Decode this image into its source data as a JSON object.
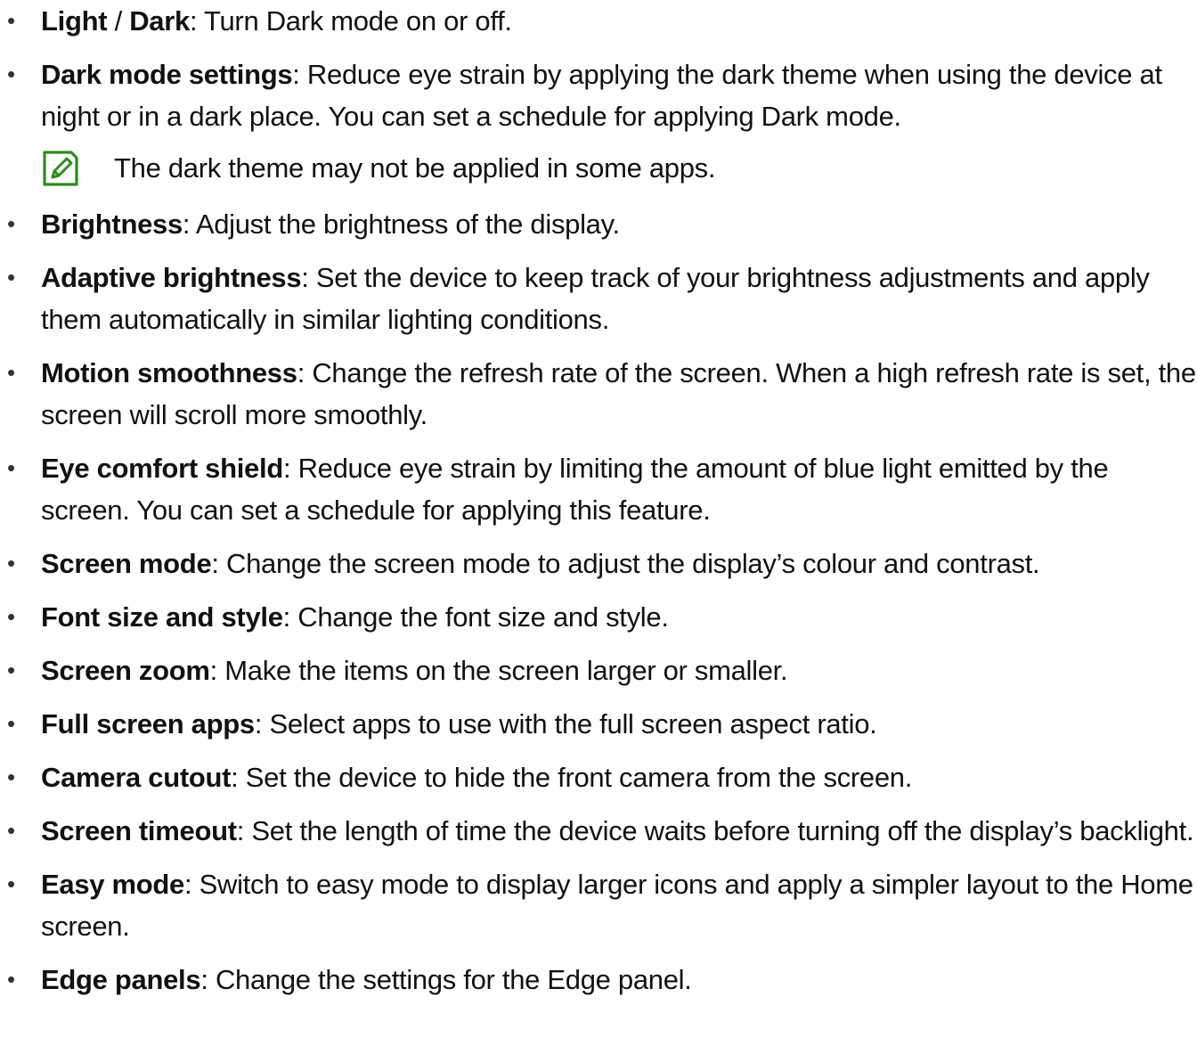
{
  "items": [
    {
      "term1": "Light",
      "sep": " / ",
      "term2": "Dark",
      "desc": ": Turn Dark mode on or off."
    },
    {
      "term": "Dark mode settings",
      "desc": ": Reduce eye strain by applying the dark theme when using the device at night or in a dark place. You can set a schedule for applying Dark mode."
    },
    {
      "term": "Brightness",
      "desc": ": Adjust the brightness of the display."
    },
    {
      "term": "Adaptive brightness",
      "desc": ": Set the device to keep track of your brightness adjustments and apply them automatically in similar lighting conditions."
    },
    {
      "term": "Motion smoothness",
      "desc": ": Change the refresh rate of the screen. When a high refresh rate is set, the screen will scroll more smoothly."
    },
    {
      "term": "Eye comfort shield",
      "desc": ": Reduce eye strain by limiting the amount of blue light emitted by the screen. You can set a schedule for applying this feature."
    },
    {
      "term": "Screen mode",
      "desc": ": Change the screen mode to adjust the display’s colour and contrast."
    },
    {
      "term": "Font size and style",
      "desc": ": Change the font size and style."
    },
    {
      "term": "Screen zoom",
      "desc": ": Make the items on the screen larger or smaller."
    },
    {
      "term": "Full screen apps",
      "desc": ": Select apps to use with the full screen aspect ratio."
    },
    {
      "term": "Camera cutout",
      "desc": ": Set the device to hide the front camera from the screen."
    },
    {
      "term": "Screen timeout",
      "desc": ": Set the length of time the device waits before turning off the display’s backlight."
    },
    {
      "term": "Easy mode",
      "desc": ": Switch to easy mode to display larger icons and apply a simpler layout to the Home screen."
    },
    {
      "term": "Edge panels",
      "desc": ": Change the settings for the Edge panel."
    }
  ],
  "note": {
    "icon": "note-pencil-icon",
    "text": "The dark theme may not be applied in some apps.",
    "color": "#2e8b1e"
  },
  "bullet": "•"
}
